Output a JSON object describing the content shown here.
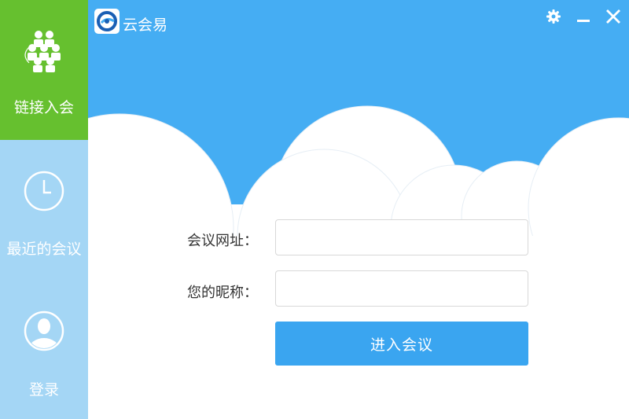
{
  "app": {
    "title": "云会易"
  },
  "window_controls": {
    "settings_icon": "gear-icon",
    "minimize_icon": "minimize-icon",
    "close_icon": "close-icon"
  },
  "sidebar": {
    "items": [
      {
        "label": "链接入会",
        "icon": "group-icon",
        "active": true
      },
      {
        "label": "最近的会议",
        "icon": "clock-icon",
        "active": false
      },
      {
        "label": "登录",
        "icon": "user-avatar-icon",
        "active": false
      }
    ]
  },
  "form": {
    "url_label": "会议网址：",
    "url_value": "",
    "nickname_label": "您的昵称：",
    "nickname_value": "",
    "submit_label": "进入会议"
  },
  "colors": {
    "sky": "#45adf3",
    "sidebar": "#a8d8f6",
    "active_item": "#66c02f",
    "button": "#3aa5f0"
  }
}
